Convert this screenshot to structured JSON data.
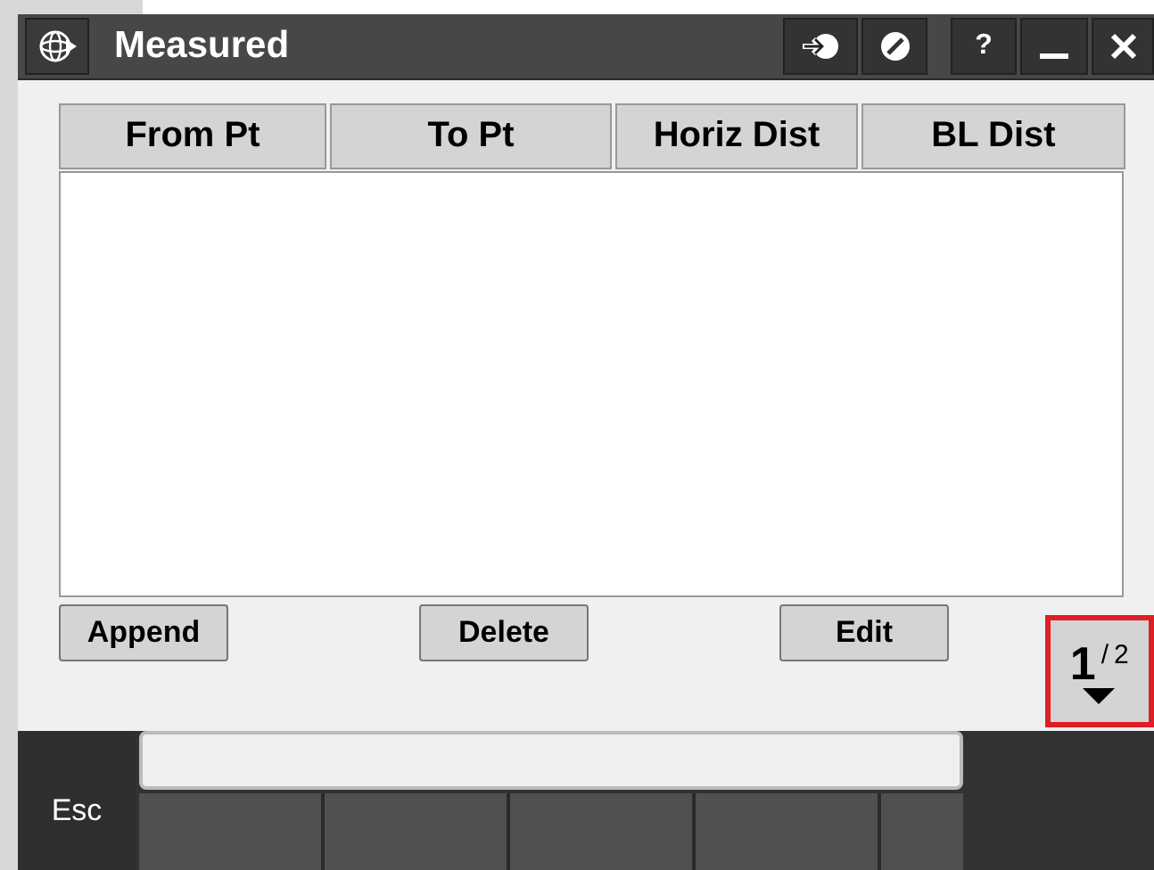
{
  "window": {
    "title": "Measured"
  },
  "title_buttons": [
    {
      "kind": "arrow"
    },
    {
      "kind": "cancel"
    },
    {
      "kind": "help",
      "label": "?"
    },
    {
      "kind": "minimize"
    },
    {
      "kind": "close"
    }
  ],
  "table": {
    "columns": [
      "From Pt",
      "To Pt",
      "Horiz Dist",
      "BL Dist"
    ]
  },
  "buttons": [
    "Append",
    "Delete",
    "Edit"
  ],
  "page_indicator": {
    "current": "1",
    "separator": "/",
    "total": "2"
  },
  "softkeys": {
    "esc": "Esc"
  }
}
